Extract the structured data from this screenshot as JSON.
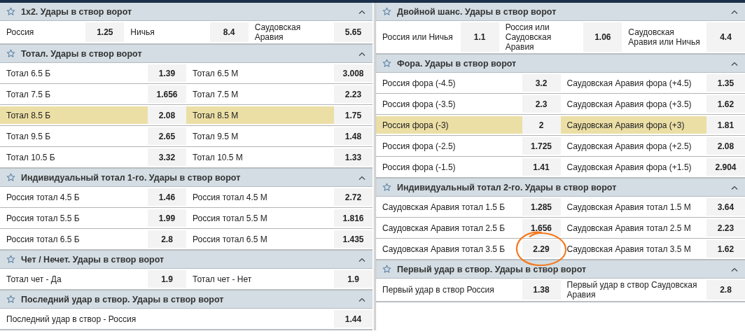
{
  "columns": [
    {
      "markets": [
        {
          "title": "1x2. Удары в створ ворот",
          "rows": [
            {
              "highlighted": false,
              "outcomes": [
                {
                  "label": "Россия",
                  "odds": "1.25",
                  "circled": false
                },
                {
                  "label": "Ничья",
                  "odds": "8.4",
                  "circled": false
                },
                {
                  "label": "Саудовская Аравия",
                  "odds": "5.65",
                  "circled": false
                }
              ]
            }
          ]
        },
        {
          "title": "Тотал. Удары в створ ворот",
          "rows": [
            {
              "highlighted": false,
              "outcomes": [
                {
                  "label": "Тотал 6.5 Б",
                  "odds": "1.39",
                  "circled": false
                },
                {
                  "label": "Тотал 6.5 М",
                  "odds": "3.008",
                  "circled": false
                }
              ]
            },
            {
              "highlighted": false,
              "outcomes": [
                {
                  "label": "Тотал 7.5 Б",
                  "odds": "1.656",
                  "circled": false
                },
                {
                  "label": "Тотал 7.5 М",
                  "odds": "2.23",
                  "circled": false
                }
              ]
            },
            {
              "highlighted": true,
              "outcomes": [
                {
                  "label": "Тотал 8.5 Б",
                  "odds": "2.08",
                  "circled": false
                },
                {
                  "label": "Тотал 8.5 М",
                  "odds": "1.75",
                  "circled": false
                }
              ]
            },
            {
              "highlighted": false,
              "outcomes": [
                {
                  "label": "Тотал 9.5 Б",
                  "odds": "2.65",
                  "circled": false
                },
                {
                  "label": "Тотал 9.5 М",
                  "odds": "1.48",
                  "circled": false
                }
              ]
            },
            {
              "highlighted": false,
              "outcomes": [
                {
                  "label": "Тотал 10.5 Б",
                  "odds": "3.32",
                  "circled": false
                },
                {
                  "label": "Тотал 10.5 М",
                  "odds": "1.33",
                  "circled": false
                }
              ]
            }
          ]
        },
        {
          "title": "Индивидуальный тотал 1-го. Удары в створ ворот",
          "rows": [
            {
              "highlighted": false,
              "outcomes": [
                {
                  "label": "Россия тотал 4.5 Б",
                  "odds": "1.46",
                  "circled": false
                },
                {
                  "label": "Россия тотал 4.5 М",
                  "odds": "2.72",
                  "circled": false
                }
              ]
            },
            {
              "highlighted": false,
              "outcomes": [
                {
                  "label": "Россия тотал 5.5 Б",
                  "odds": "1.99",
                  "circled": false
                },
                {
                  "label": "Россия тотал 5.5 М",
                  "odds": "1.816",
                  "circled": false
                }
              ]
            },
            {
              "highlighted": false,
              "outcomes": [
                {
                  "label": "Россия тотал 6.5 Б",
                  "odds": "2.8",
                  "circled": false
                },
                {
                  "label": "Россия тотал 6.5 М",
                  "odds": "1.435",
                  "circled": false
                }
              ]
            }
          ]
        },
        {
          "title": "Чет / Нечет. Удары в створ ворот",
          "rows": [
            {
              "highlighted": false,
              "outcomes": [
                {
                  "label": "Тотал чет - Да",
                  "odds": "1.9",
                  "circled": false
                },
                {
                  "label": "Тотал чет - Нет",
                  "odds": "1.9",
                  "circled": false
                }
              ]
            }
          ]
        },
        {
          "title": "Последний удар в створ. Удары в створ ворот",
          "rows": [
            {
              "highlighted": false,
              "outcomes": [
                {
                  "label": "Последний удар в створ - Россия",
                  "odds": "1.44",
                  "circled": false
                }
              ]
            }
          ]
        }
      ]
    },
    {
      "markets": [
        {
          "title": "Двойной шанс. Удары в створ ворот",
          "rows": [
            {
              "highlighted": false,
              "outcomes": [
                {
                  "label": "Россия или Ничья",
                  "odds": "1.1",
                  "circled": false
                },
                {
                  "label": "Россия или Саудовская Аравия",
                  "odds": "1.06",
                  "circled": false
                },
                {
                  "label": "Саудовская Аравия или Ничья",
                  "odds": "4.4",
                  "circled": false
                }
              ]
            }
          ]
        },
        {
          "title": "Фора. Удары в створ ворот",
          "rows": [
            {
              "highlighted": false,
              "outcomes": [
                {
                  "label": "Россия фора (-4.5)",
                  "odds": "3.2",
                  "circled": false
                },
                {
                  "label": "Саудовская Аравия фора (+4.5)",
                  "odds": "1.35",
                  "circled": false
                }
              ]
            },
            {
              "highlighted": false,
              "outcomes": [
                {
                  "label": "Россия фора (-3.5)",
                  "odds": "2.3",
                  "circled": false
                },
                {
                  "label": "Саудовская Аравия фора (+3.5)",
                  "odds": "1.62",
                  "circled": false
                }
              ]
            },
            {
              "highlighted": true,
              "outcomes": [
                {
                  "label": "Россия фора (-3)",
                  "odds": "2",
                  "circled": false
                },
                {
                  "label": "Саудовская Аравия фора (+3)",
                  "odds": "1.81",
                  "circled": false
                }
              ]
            },
            {
              "highlighted": false,
              "outcomes": [
                {
                  "label": "Россия фора (-2.5)",
                  "odds": "1.725",
                  "circled": false
                },
                {
                  "label": "Саудовская Аравия фора (+2.5)",
                  "odds": "2.08",
                  "circled": false
                }
              ]
            },
            {
              "highlighted": false,
              "outcomes": [
                {
                  "label": "Россия фора (-1.5)",
                  "odds": "1.41",
                  "circled": false
                },
                {
                  "label": "Саудовская Аравия фора (+1.5)",
                  "odds": "2.904",
                  "circled": false
                }
              ]
            }
          ]
        },
        {
          "title": "Индивидуальный тотал 2-го. Удары в створ ворот",
          "rows": [
            {
              "highlighted": false,
              "outcomes": [
                {
                  "label": "Саудовская Аравия тотал 1.5 Б",
                  "odds": "1.285",
                  "circled": false
                },
                {
                  "label": "Саудовская Аравия тотал 1.5 М",
                  "odds": "3.64",
                  "circled": false
                }
              ]
            },
            {
              "highlighted": false,
              "outcomes": [
                {
                  "label": "Саудовская Аравия тотал 2.5 Б",
                  "odds": "1.656",
                  "circled": false
                },
                {
                  "label": "Саудовская Аравия тотал 2.5 М",
                  "odds": "2.23",
                  "circled": false
                }
              ]
            },
            {
              "highlighted": false,
              "outcomes": [
                {
                  "label": "Саудовская Аравия тотал 3.5 Б",
                  "odds": "2.29",
                  "circled": true
                },
                {
                  "label": "Саудовская Аравия тотал 3.5 М",
                  "odds": "1.62",
                  "circled": false
                }
              ]
            }
          ]
        },
        {
          "title": "Первый удар в створ. Удары в створ ворот",
          "rows": [
            {
              "highlighted": false,
              "outcomes": [
                {
                  "label": "Первый удар в створ Россия",
                  "odds": "1.38",
                  "circled": false
                },
                {
                  "label": "Первый удар в створ Саудовская Аравия",
                  "odds": "2.8",
                  "circled": false
                }
              ]
            }
          ]
        }
      ]
    }
  ]
}
